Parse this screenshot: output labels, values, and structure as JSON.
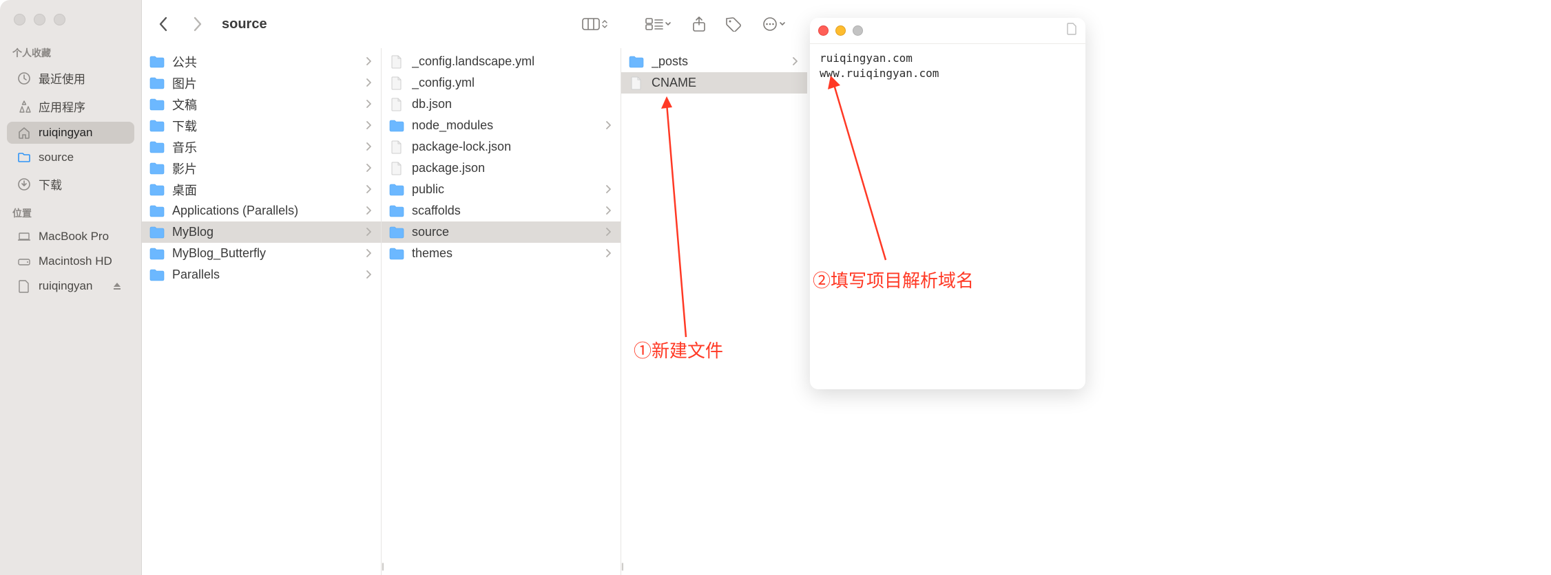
{
  "finder": {
    "title": "source",
    "sidebar": {
      "favorites_header": "个人收藏",
      "locations_header": "位置",
      "favorites": [
        {
          "label": "最近使用",
          "icon": "clock"
        },
        {
          "label": "应用程序",
          "icon": "apps"
        },
        {
          "label": "ruiqingyan",
          "icon": "home",
          "selected": true
        },
        {
          "label": "source",
          "icon": "folder"
        },
        {
          "label": "下载",
          "icon": "download"
        }
      ],
      "locations": [
        {
          "label": "MacBook Pro",
          "icon": "laptop"
        },
        {
          "label": "Macintosh HD",
          "icon": "disk"
        },
        {
          "label": "ruiqingyan",
          "icon": "doc",
          "eject": true
        }
      ]
    },
    "columns": [
      {
        "items": [
          {
            "label": "公共",
            "type": "folder",
            "chev": true
          },
          {
            "label": "图片",
            "type": "folder",
            "chev": true
          },
          {
            "label": "文稿",
            "type": "folder",
            "chev": true
          },
          {
            "label": "下载",
            "type": "folder",
            "chev": true
          },
          {
            "label": "音乐",
            "type": "folder",
            "chev": true
          },
          {
            "label": "影片",
            "type": "folder",
            "chev": true
          },
          {
            "label": "桌面",
            "type": "folder",
            "chev": true
          },
          {
            "label": "Applications (Parallels)",
            "type": "folder",
            "chev": true
          },
          {
            "label": "MyBlog",
            "type": "folder",
            "chev": true,
            "selected": true
          },
          {
            "label": "MyBlog_Butterfly",
            "type": "folder",
            "chev": true
          },
          {
            "label": "Parallels",
            "type": "folder",
            "chev": true
          }
        ]
      },
      {
        "items": [
          {
            "label": "_config.landscape.yml",
            "type": "file"
          },
          {
            "label": "_config.yml",
            "type": "file"
          },
          {
            "label": "db.json",
            "type": "file"
          },
          {
            "label": "node_modules",
            "type": "folder",
            "chev": true
          },
          {
            "label": "package-lock.json",
            "type": "file"
          },
          {
            "label": "package.json",
            "type": "file"
          },
          {
            "label": "public",
            "type": "folder",
            "chev": true
          },
          {
            "label": "scaffolds",
            "type": "folder",
            "chev": true
          },
          {
            "label": "source",
            "type": "folder",
            "chev": true,
            "selected": true
          },
          {
            "label": "themes",
            "type": "folder",
            "chev": true
          }
        ]
      },
      {
        "items": [
          {
            "label": "_posts",
            "type": "folder",
            "chev": true
          },
          {
            "label": "CNAME",
            "type": "file",
            "selected": true
          }
        ]
      }
    ]
  },
  "textedit": {
    "content": "ruiqingyan.com\nwww.ruiqingyan.com"
  },
  "annotations": {
    "a1": "①新建文件",
    "a2": "②填写项目解析域名"
  }
}
